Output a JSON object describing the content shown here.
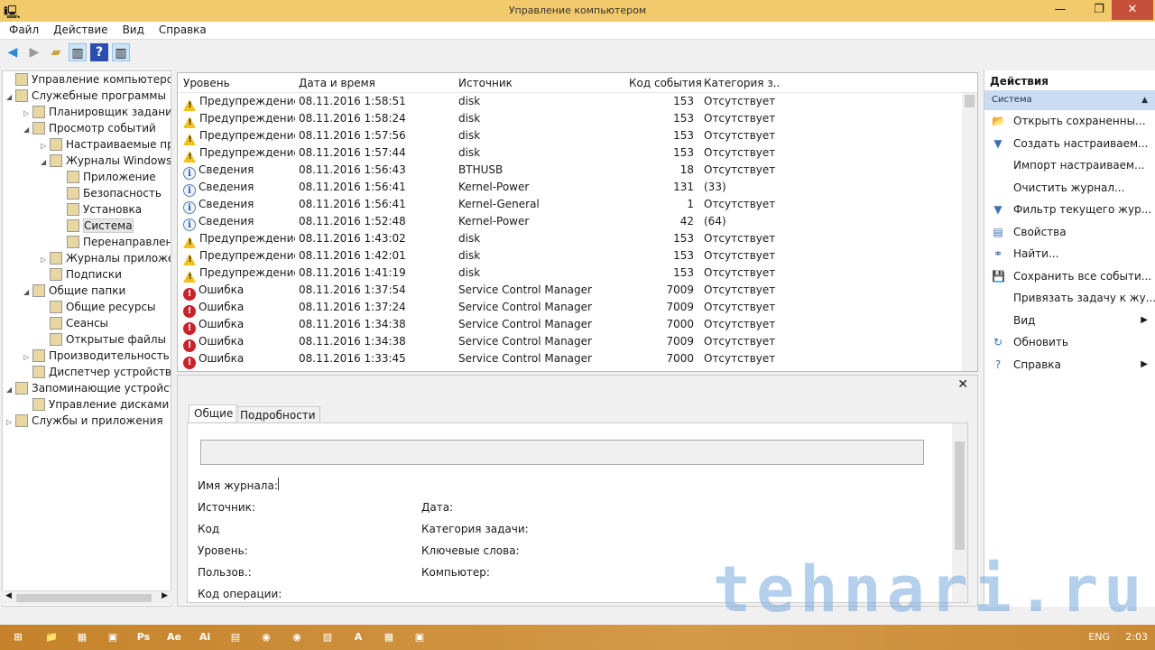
{
  "window": {
    "title": "Управление компьютером",
    "minimize": "—",
    "maximize": "❐",
    "close": "✕"
  },
  "menu": [
    "Файл",
    "Действие",
    "Вид",
    "Справка"
  ],
  "tree": [
    {
      "label": "Управление компьютером (л",
      "level": 0,
      "exp": ""
    },
    {
      "label": "Служебные программы",
      "level": 0,
      "exp": "◢"
    },
    {
      "label": "Планировщик заданий",
      "level": 1,
      "exp": "▷"
    },
    {
      "label": "Просмотр событий",
      "level": 1,
      "exp": "◢"
    },
    {
      "label": "Настраиваемые пр",
      "level": 2,
      "exp": "▷"
    },
    {
      "label": "Журналы Windows",
      "level": 2,
      "exp": "◢"
    },
    {
      "label": "Приложение",
      "level": 3,
      "exp": ""
    },
    {
      "label": "Безопасность",
      "level": 3,
      "exp": ""
    },
    {
      "label": "Установка",
      "level": 3,
      "exp": ""
    },
    {
      "label": "Система",
      "level": 3,
      "exp": "",
      "selected": true
    },
    {
      "label": "Перенаправлен",
      "level": 3,
      "exp": ""
    },
    {
      "label": "Журналы приложе",
      "level": 2,
      "exp": "▷"
    },
    {
      "label": "Подписки",
      "level": 2,
      "exp": ""
    },
    {
      "label": "Общие папки",
      "level": 1,
      "exp": "◢"
    },
    {
      "label": "Общие ресурсы",
      "level": 2,
      "exp": ""
    },
    {
      "label": "Сеансы",
      "level": 2,
      "exp": ""
    },
    {
      "label": "Открытые файлы",
      "level": 2,
      "exp": ""
    },
    {
      "label": "Производительность",
      "level": 1,
      "exp": "▷"
    },
    {
      "label": "Диспетчер устройств",
      "level": 1,
      "exp": ""
    },
    {
      "label": "Запоминающие устройст",
      "level": 0,
      "exp": "◢"
    },
    {
      "label": "Управление дисками",
      "level": 1,
      "exp": ""
    },
    {
      "label": "Службы и приложения",
      "level": 0,
      "exp": "▷"
    }
  ],
  "columns": [
    "Уровень",
    "Дата и время",
    "Источник",
    "Код события",
    "Категория з..."
  ],
  "events": [
    {
      "type": "warn",
      "level": "Предупреждение",
      "date": "08.11.2016 1:58:51",
      "source": "disk",
      "code": "153",
      "cat": "Отсутствует"
    },
    {
      "type": "warn",
      "level": "Предупреждение",
      "date": "08.11.2016 1:58:24",
      "source": "disk",
      "code": "153",
      "cat": "Отсутствует"
    },
    {
      "type": "warn",
      "level": "Предупреждение",
      "date": "08.11.2016 1:57:56",
      "source": "disk",
      "code": "153",
      "cat": "Отсутствует"
    },
    {
      "type": "warn",
      "level": "Предупреждение",
      "date": "08.11.2016 1:57:44",
      "source": "disk",
      "code": "153",
      "cat": "Отсутствует"
    },
    {
      "type": "info",
      "level": "Сведения",
      "date": "08.11.2016 1:56:43",
      "source": "BTHUSB",
      "code": "18",
      "cat": "Отсутствует"
    },
    {
      "type": "info",
      "level": "Сведения",
      "date": "08.11.2016 1:56:41",
      "source": "Kernel-Power",
      "code": "131",
      "cat": "(33)"
    },
    {
      "type": "info",
      "level": "Сведения",
      "date": "08.11.2016 1:56:41",
      "source": "Kernel-General",
      "code": "1",
      "cat": "Отсутствует"
    },
    {
      "type": "info",
      "level": "Сведения",
      "date": "08.11.2016 1:52:48",
      "source": "Kernel-Power",
      "code": "42",
      "cat": "(64)"
    },
    {
      "type": "warn",
      "level": "Предупреждение",
      "date": "08.11.2016 1:43:02",
      "source": "disk",
      "code": "153",
      "cat": "Отсутствует"
    },
    {
      "type": "warn",
      "level": "Предупреждение",
      "date": "08.11.2016 1:42:01",
      "source": "disk",
      "code": "153",
      "cat": "Отсутствует"
    },
    {
      "type": "warn",
      "level": "Предупреждение",
      "date": "08.11.2016 1:41:19",
      "source": "disk",
      "code": "153",
      "cat": "Отсутствует"
    },
    {
      "type": "err",
      "level": "Ошибка",
      "date": "08.11.2016 1:37:54",
      "source": "Service Control Manager",
      "code": "7009",
      "cat": "Отсутствует"
    },
    {
      "type": "err",
      "level": "Ошибка",
      "date": "08.11.2016 1:37:24",
      "source": "Service Control Manager",
      "code": "7009",
      "cat": "Отсутствует"
    },
    {
      "type": "err",
      "level": "Ошибка",
      "date": "08.11.2016 1:34:38",
      "source": "Service Control Manager",
      "code": "7000",
      "cat": "Отсутствует"
    },
    {
      "type": "err",
      "level": "Ошибка",
      "date": "08.11.2016 1:34:38",
      "source": "Service Control Manager",
      "code": "7009",
      "cat": "Отсутствует"
    },
    {
      "type": "err",
      "level": "Ошибка",
      "date": "08.11.2016 1:33:45",
      "source": "Service Control Manager",
      "code": "7000",
      "cat": "Отсутствует"
    }
  ],
  "detail": {
    "tabs": [
      "Общие",
      "Подробности"
    ],
    "close": "✕",
    "fields": {
      "log": "Имя журнала:",
      "source": "Источник:",
      "code": "Код",
      "level": "Уровень:",
      "user": "Пользов.:",
      "opcode": "Код операции:",
      "date": "Дата:",
      "task": "Категория задачи:",
      "keywords": "Ключевые слова:",
      "computer": "Компьютер:"
    }
  },
  "actions": {
    "title": "Действия",
    "section": "Система",
    "items": [
      {
        "label": "Открыть сохраненны...",
        "icon": "📂"
      },
      {
        "label": "Создать настраиваем...",
        "icon": "▼"
      },
      {
        "label": "Импорт настраиваем...",
        "icon": ""
      },
      {
        "label": "Очистить журнал...",
        "icon": ""
      },
      {
        "label": "Фильтр текущего жур...",
        "icon": "▼"
      },
      {
        "label": "Свойства",
        "icon": "▤"
      },
      {
        "label": "Найти...",
        "icon": "⚭"
      },
      {
        "label": "Сохранить все событи...",
        "icon": "💾"
      },
      {
        "label": "Привязать задачу к жу...",
        "icon": ""
      },
      {
        "label": "Вид",
        "icon": "",
        "arrow": "▶"
      },
      {
        "label": "Обновить",
        "icon": "↻"
      },
      {
        "label": "Справка",
        "icon": "?",
        "arrow": "▶"
      }
    ]
  },
  "taskbar": {
    "apps": [
      "⊞",
      "📁",
      "▦",
      "▣",
      "Ps",
      "Ae",
      "Ai",
      "▤",
      "◉",
      "◉",
      "▨",
      "A",
      "▦",
      "▣"
    ],
    "lang": "ENG",
    "time": "2:03"
  },
  "watermark": "tehnari.ru"
}
